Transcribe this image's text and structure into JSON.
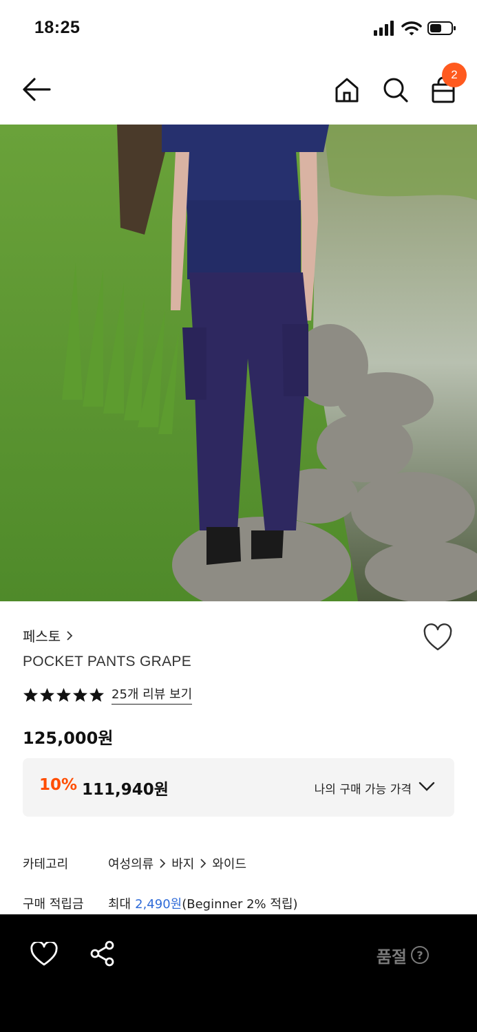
{
  "status_bar": {
    "time": "18:25"
  },
  "header": {
    "cart_count": "2"
  },
  "product": {
    "brand": "페스토",
    "name": "POCKET PANTS GRAPE",
    "rating_stars": 5,
    "review_link": "25개 리뷰 보기",
    "price": "125,000원",
    "discount_rate": "10%",
    "discount_price": "111,940원",
    "my_price_label": "나의 구매 가능 가격"
  },
  "info": {
    "category_label": "카테고리",
    "category_path": [
      "여성의류",
      "바지",
      "와이드"
    ],
    "points_label": "구매 적립금",
    "points_prefix": "최대",
    "points_value": "2,490원",
    "points_suffix": "(Beginner 2% 적립)"
  },
  "bottom_bar": {
    "soldout_label": "품절"
  },
  "colors": {
    "accent": "#ff4d00",
    "badge": "#ff5a1f",
    "link": "#2f6bd8",
    "bar": "#000000"
  }
}
